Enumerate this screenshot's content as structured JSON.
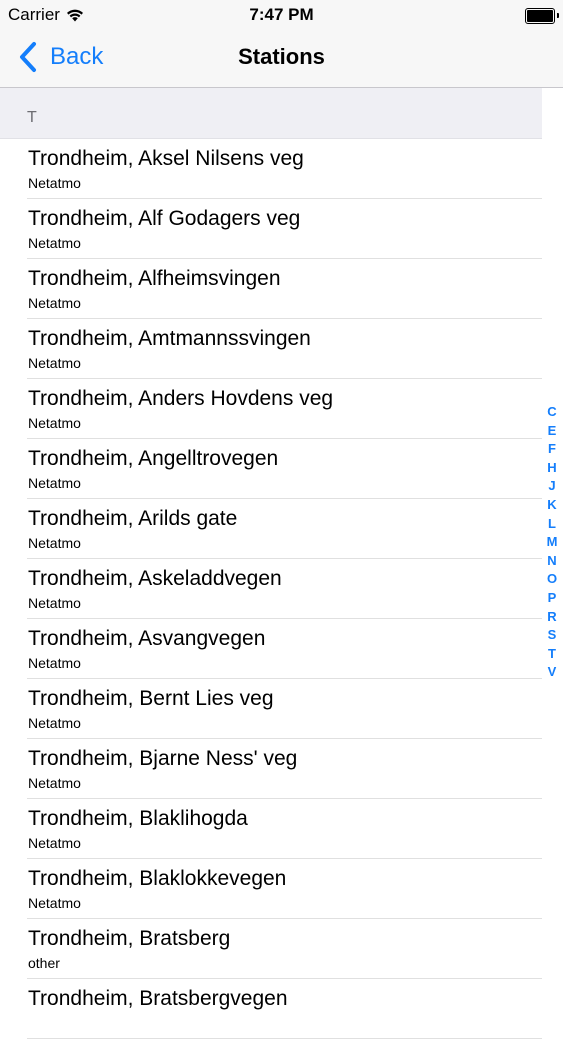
{
  "status": {
    "carrier": "Carrier",
    "time": "7:47 PM"
  },
  "nav": {
    "back_label": "Back",
    "title": "Stations"
  },
  "section": {
    "header": "T"
  },
  "stations": [
    {
      "name": "Trondheim, Aksel Nilsens veg",
      "source": "Netatmo"
    },
    {
      "name": "Trondheim, Alf Godagers veg",
      "source": "Netatmo"
    },
    {
      "name": "Trondheim, Alfheimsvingen",
      "source": "Netatmo"
    },
    {
      "name": "Trondheim, Amtmannssvingen",
      "source": "Netatmo"
    },
    {
      "name": "Trondheim, Anders Hovdens veg",
      "source": "Netatmo"
    },
    {
      "name": "Trondheim, Angelltrovegen",
      "source": "Netatmo"
    },
    {
      "name": "Trondheim, Arilds gate",
      "source": "Netatmo"
    },
    {
      "name": "Trondheim, Askeladdvegen",
      "source": "Netatmo"
    },
    {
      "name": "Trondheim, Asvangvegen",
      "source": "Netatmo"
    },
    {
      "name": "Trondheim, Bernt Lies veg",
      "source": "Netatmo"
    },
    {
      "name": "Trondheim, Bjarne Ness' veg",
      "source": "Netatmo"
    },
    {
      "name": "Trondheim, Blaklihogda",
      "source": "Netatmo"
    },
    {
      "name": "Trondheim, Blaklokkevegen",
      "source": "Netatmo"
    },
    {
      "name": "Trondheim, Bratsberg",
      "source": "other"
    },
    {
      "name": "Trondheim, Bratsbergvegen",
      "source": ""
    }
  ],
  "index": [
    "C",
    "E",
    "F",
    "H",
    "J",
    "K",
    "L",
    "M",
    "N",
    "O",
    "P",
    "R",
    "S",
    "T",
    "V"
  ],
  "colors": {
    "accent": "#147efb",
    "nav_background": "#f7f7f7",
    "section_background": "#efeff4"
  }
}
